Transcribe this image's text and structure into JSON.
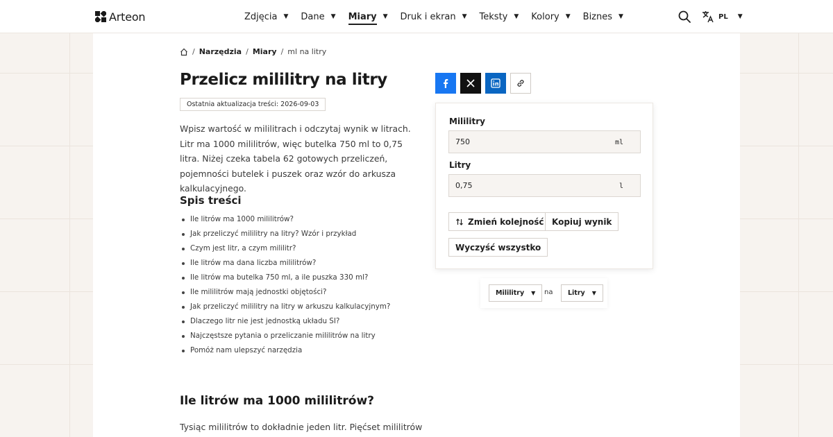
{
  "brand": {
    "name": "Arteon"
  },
  "nav": {
    "items": [
      {
        "label": "Zdjęcia",
        "active": false
      },
      {
        "label": "Dane",
        "active": false
      },
      {
        "label": "Miary",
        "active": true
      },
      {
        "label": "Druk i ekran",
        "active": false
      },
      {
        "label": "Teksty",
        "active": false
      },
      {
        "label": "Kolory",
        "active": false
      },
      {
        "label": "Biznes",
        "active": false
      }
    ],
    "language": "PL"
  },
  "breadcrumb": {
    "items": [
      "Narzędzia",
      "Miary"
    ],
    "current": "ml na litry"
  },
  "page": {
    "title": "Przelicz mililitry na litry",
    "updated": "Ostatnia aktualizacja treści: 2026-09-03",
    "intro": "Wpisz wartość w mililitrach i odczytaj wynik w litrach. Litr ma 1000 mililitrów, więc butelka 750 ml to 0,75 litra. Niżej czeka tabela 62 gotowych przeliczeń, pojemności butelek i puszek oraz wzór do arkusza kalkulacyjnego."
  },
  "toc": {
    "title": "Spis treści",
    "items": [
      "Ile litrów ma 1000 mililitrów?",
      "Jak przeliczyć mililitry na litry? Wzór i przykład",
      "Czym jest litr, a czym mililitr?",
      "Ile litrów ma dana liczba mililitrów?",
      "Ile litrów ma butelka 750 ml, a ile puszka 330 ml?",
      "Ile mililitrów mają jednostki objętości?",
      "Jak przeliczyć mililitry na litry w arkuszu kalkulacyjnym?",
      "Dlaczego litr nie jest jednostką układu SI?",
      "Najczęstsze pytania o przeliczanie mililitrów na litry",
      "Pomóż nam ulepszyć narzędzia"
    ]
  },
  "section": {
    "heading": "Ile litrów ma 1000 mililitrów?",
    "text": "Tysiąc mililitrów to dokładnie jeden litr. Pięćset mililitrów"
  },
  "converter": {
    "from": {
      "label": "Mililitry",
      "value": "750",
      "unit": "ml"
    },
    "to": {
      "label": "Litry",
      "value": "0,75",
      "unit": "l"
    },
    "swap_label": "Zmień kolejność",
    "copy_label": "Kopiuj wynik",
    "clear_label": "Wyczyść wszystko"
  },
  "unit_selector": {
    "from": "Mililitry",
    "connector": "na",
    "to": "Litry"
  },
  "colors": {
    "facebook": "#1877f2",
    "x": "#111111",
    "linkedin": "#0a66c2"
  }
}
